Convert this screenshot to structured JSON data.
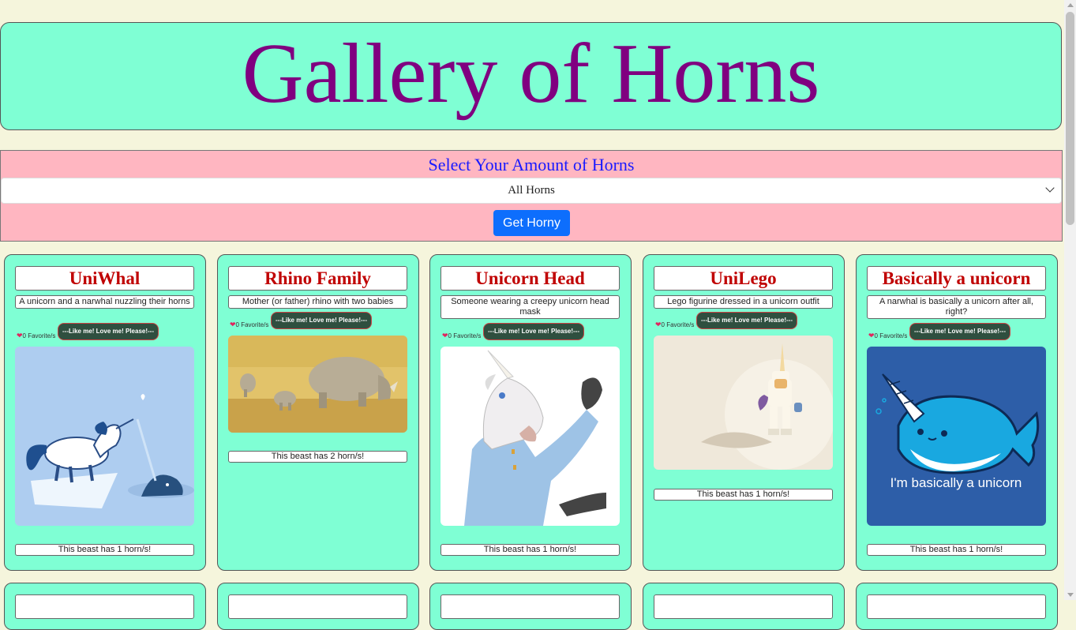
{
  "header": {
    "title": "Gallery of Horns"
  },
  "filter": {
    "title": "Select Your Amount of Horns",
    "selected": "All Horns",
    "button": "Get Horny"
  },
  "cards": [
    {
      "title": "UniWhal",
      "description": "A unicorn and a narwhal nuzzling their horns",
      "favorites": "0 Favorite/s",
      "like": "---Like me! Love me! Please!---",
      "horns": "This beast has 1 horn/s!",
      "image": "unicorn-narwhal-illustration"
    },
    {
      "title": "Rhino Family",
      "description": "Mother (or father) rhino with two babies",
      "favorites": "0 Favorite/s",
      "like": "---Like me! Love me! Please!---",
      "horns": "This beast has 2 horn/s!",
      "image": "rhino-family-photo"
    },
    {
      "title": "Unicorn Head",
      "description": "Someone wearing a creepy unicorn head mask",
      "favorites": "0 Favorite/s",
      "like": "---Like me! Love me! Please!---",
      "horns": "This beast has 1 horn/s!",
      "image": "unicorn-mask-photo"
    },
    {
      "title": "UniLego",
      "description": "Lego figurine dressed in a unicorn outfit",
      "favorites": "0 Favorite/s",
      "like": "---Like me! Love me! Please!---",
      "horns": "This beast has 1 horn/s!",
      "image": "lego-unicorn-photo"
    },
    {
      "title": "Basically a unicorn",
      "description": "A narwhal is basically a unicorn after all, right?",
      "favorites": "0 Favorite/s",
      "like": "---Like me! Love me! Please!---",
      "horns": "This beast has 1 horn/s!",
      "image": "narwhal-illustration",
      "image_text": "I'm basically a unicorn"
    }
  ],
  "colors": {
    "page_bg": "#f5f5dc",
    "header_bg": "#7fffd4",
    "title_color": "#800080",
    "filter_bg": "#ffb6c1",
    "filter_title": "#1a1aff",
    "button_bg": "#0d6efd",
    "card_title": "#c00000",
    "like_bg": "#2f4f3f"
  }
}
